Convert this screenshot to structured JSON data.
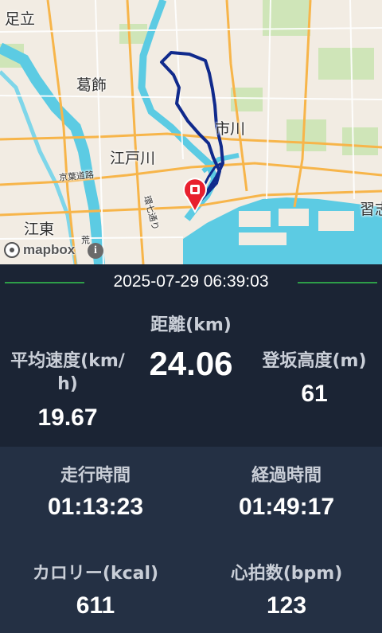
{
  "map": {
    "place_labels": {
      "adachi": "足立",
      "katsushika": "葛飾",
      "edogawa": "江戸川",
      "koto": "江東",
      "ichikawa": "市川",
      "narashino": "習志",
      "keiyo_road": "京葉道路",
      "kan7": "環七通り",
      "ara": "荒"
    },
    "attribution": "mapbox",
    "info_glyph": "i"
  },
  "activity": {
    "datetime": "2025-07-29 06:39:03",
    "distance_label": "距離(km)",
    "distance_value": "24.06",
    "avg_speed_label": "平均速度(km/h)",
    "avg_speed_label_line1": "平均速度(km/",
    "avg_speed_label_line2": "h)",
    "avg_speed_value": "19.67",
    "climb_label": "登坂高度(m)",
    "climb_value": "61",
    "moving_time_label": "走行時間",
    "moving_time_value": "01:13:23",
    "elapsed_time_label": "経過時間",
    "elapsed_time_value": "01:49:17",
    "calories_label": "カロリー(kcal)",
    "calories_value": "611",
    "heart_rate_label": "心拍数(bpm)",
    "heart_rate_value": "123"
  },
  "colors": {
    "route": "#102a8c",
    "marker": "#e8202e",
    "accent_line": "#2e9e48",
    "panel_dark": "#1b2434",
    "panel_light": "#243044"
  }
}
